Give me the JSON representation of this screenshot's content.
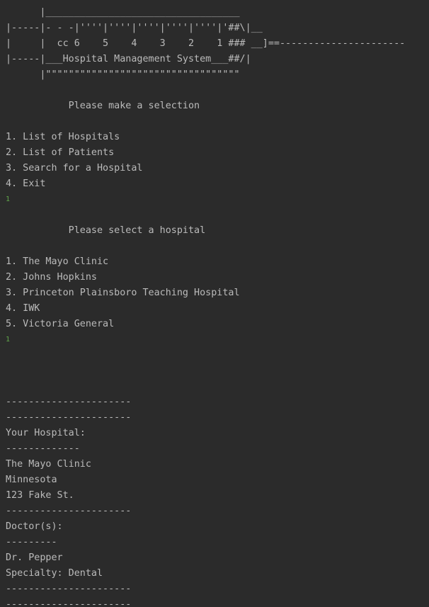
{
  "console": {
    "banner": [
      "      |__________________________________",
      "|-----|- - -|''''|''''|''''|''''|''''|'##\\|__",
      "|     |  cc 6    5    4    3    2    1 ### __]==----------------------",
      "|-----|___Hospital Management System___##/|",
      "      |\"\"\"\"\"\"\"\"\"\"\"\"\"\"\"\"\"\"\"\"\"\"\"\"\"\"\"\"\"\"\"\"\"\""
    ],
    "menu_prompt": "           Please make a selection",
    "menu_items": [
      "1. List of Hospitals",
      "2. List of Patients",
      "3. Search for a Hospital",
      "4. Exit"
    ],
    "menu_input": "1",
    "hospital_prompt": "           Please select a hospital",
    "hospital_items": [
      "1. The Mayo Clinic",
      "2. Johns Hopkins",
      "3. Princeton Plainsboro Teaching Hospital",
      "4. IWK",
      "5. Victoria General"
    ],
    "hospital_input": "1",
    "output": [
      "----------------------",
      "----------------------",
      "Your Hospital:",
      "-------------",
      "The Mayo Clinic",
      "Minnesota",
      "123 Fake St.",
      "----------------------",
      "Doctor(s):",
      "---------",
      "Dr. Pepper",
      "Specialty: Dental",
      "----------------------",
      "----------------------"
    ]
  }
}
